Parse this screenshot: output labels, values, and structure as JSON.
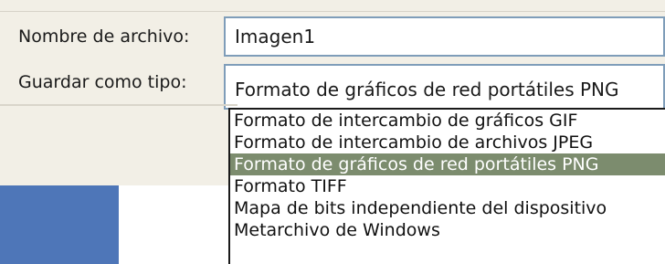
{
  "dialog": {
    "filename_label": "Nombre de archivo:",
    "filename_value": "Imagen1",
    "type_label": "Guardar como tipo:",
    "type_value": "Formato de gráficos de red portátiles PNG"
  },
  "dropdown": {
    "options": [
      "Formato de intercambio de gráficos GIF",
      "Formato de intercambio de archivos JPEG",
      "Formato de gráficos de red portátiles PNG",
      "Formato TIFF",
      "Mapa de bits independiente del dispositivo",
      "Metarchivo de Windows"
    ],
    "selected_index": 2
  },
  "colors": {
    "dialog_bg": "#f2efe6",
    "field_border": "#7f9db9",
    "selection": "#7c8c6e",
    "sidebar_blue": "#4e76b8"
  }
}
